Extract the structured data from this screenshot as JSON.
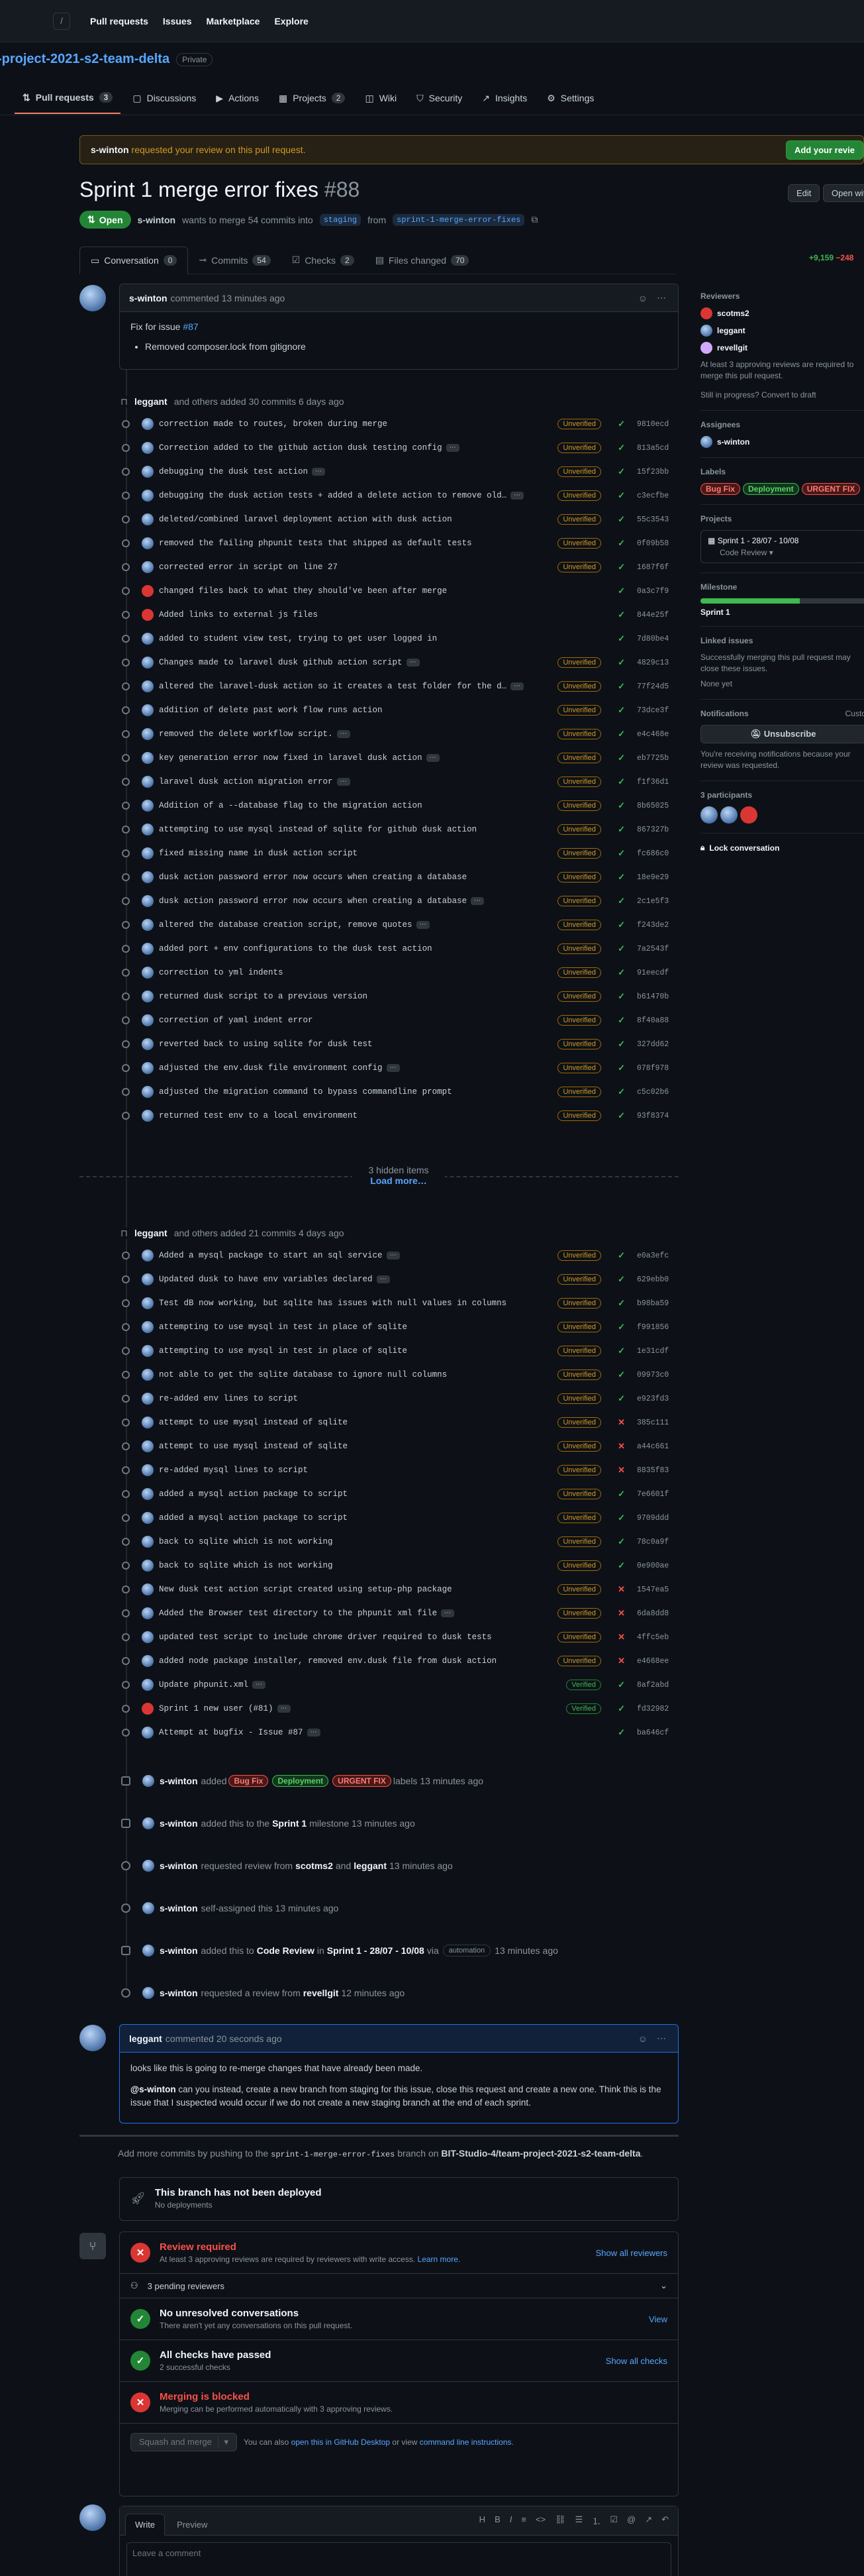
{
  "nav": {
    "items": [
      "Pull requests",
      "Issues",
      "Marketplace",
      "Explore"
    ]
  },
  "repo": {
    "name": "-project-2021-s2-team-delta",
    "visibility": "Private"
  },
  "tabs": [
    {
      "label": "Pull requests",
      "count": "3"
    },
    {
      "label": "Discussions"
    },
    {
      "label": "Actions"
    },
    {
      "label": "Projects",
      "count": "2"
    },
    {
      "label": "Wiki"
    },
    {
      "label": "Security"
    },
    {
      "label": "Insights"
    },
    {
      "label": "Settings"
    }
  ],
  "banner": {
    "user": "s-winton",
    "text": "requested your review on this pull request.",
    "button": "Add your revie"
  },
  "pr": {
    "title": "Sprint 1 merge error fixes",
    "number": "#88",
    "state": "Open",
    "author": "s-winton",
    "merge_text": "wants to merge 54 commits into",
    "base": "staging",
    "from": "from",
    "head": "sprint-1-merge-error-fixes",
    "edit": "Edit",
    "open_with": "Open with"
  },
  "pr_tabs": [
    {
      "label": "Conversation",
      "count": "0"
    },
    {
      "label": "Commits",
      "count": "54"
    },
    {
      "label": "Checks",
      "count": "2"
    },
    {
      "label": "Files changed",
      "count": "70"
    }
  ],
  "diffstat": {
    "add": "+9,159",
    "del": "−248"
  },
  "first_comment": {
    "author": "s-winton",
    "meta": "commented 13 minutes ago",
    "line1": "Fix for issue",
    "issue": "#87",
    "bullet": "Removed composer.lock from gitignore"
  },
  "group1": {
    "author": "leggant",
    "text": "and others added 30 commits 6 days ago"
  },
  "commits1": [
    {
      "msg": "correction made to routes, broken during merge",
      "badge": "Unverified",
      "status": "ok",
      "sha": "9810ecd"
    },
    {
      "msg": "Correction added to the github action dusk testing config",
      "more": true,
      "badge": "Unverified",
      "status": "ok",
      "sha": "813a5cd"
    },
    {
      "msg": "debugging the dusk test action",
      "more": true,
      "badge": "Unverified",
      "status": "ok",
      "sha": "15f23bb"
    },
    {
      "msg": "debugging the dusk action tests + added a delete action to remove old…",
      "more": true,
      "badge": "Unverified",
      "status": "ok",
      "sha": "c3ecfbe"
    },
    {
      "msg": "deleted/combined laravel deployment action with dusk action",
      "badge": "Unverified",
      "status": "ok",
      "sha": "55c3543"
    },
    {
      "msg": "removed the failing phpunit tests that shipped as default tests",
      "badge": "Unverified",
      "status": "ok",
      "sha": "0f09b58"
    },
    {
      "msg": "corrected error in script on line 27",
      "badge": "Unverified",
      "status": "ok",
      "sha": "1687f6f"
    },
    {
      "msg": "changed files back to what they should've been after merge",
      "av": "red",
      "status": "ok",
      "sha": "0a3c7f9"
    },
    {
      "msg": "Added links to external js files",
      "av": "red",
      "status": "ok",
      "sha": "844e25f"
    },
    {
      "msg": "added to student view test, trying to get user logged in",
      "status": "ok",
      "sha": "7d80be4"
    },
    {
      "msg": "Changes made to laravel dusk github action script",
      "more": true,
      "badge": "Unverified",
      "status": "ok",
      "sha": "4829c13"
    },
    {
      "msg": "altered the laravel-dusk action so it creates a test folder for the d…",
      "more": true,
      "badge": "Unverified",
      "status": "ok",
      "sha": "77f24d5"
    },
    {
      "msg": "addition of delete past work flow runs action",
      "badge": "Unverified",
      "status": "ok",
      "sha": "73dce3f"
    },
    {
      "msg": "removed the delete workflow script.",
      "more": true,
      "badge": "Unverified",
      "status": "ok",
      "sha": "e4c468e"
    },
    {
      "msg": "key generation error now fixed in laravel dusk action",
      "more": true,
      "badge": "Unverified",
      "status": "ok",
      "sha": "eb7725b"
    },
    {
      "msg": "laravel dusk action migration error",
      "more": true,
      "badge": "Unverified",
      "status": "ok",
      "sha": "f1f36d1"
    },
    {
      "msg": "Addition of a --database flag to the migration action",
      "badge": "Unverified",
      "status": "ok",
      "sha": "8b65025"
    },
    {
      "msg": "attempting to use mysql instead of sqlite for github dusk action",
      "badge": "Unverified",
      "status": "ok",
      "sha": "867327b"
    },
    {
      "msg": "fixed missing name in dusk action script",
      "badge": "Unverified",
      "status": "ok",
      "sha": "fc686c0"
    },
    {
      "msg": "dusk action password error now occurs when creating a database",
      "badge": "Unverified",
      "status": "ok",
      "sha": "18e9e29"
    },
    {
      "msg": "dusk action password error now occurs when creating a database",
      "more": true,
      "badge": "Unverified",
      "status": "ok",
      "sha": "2c1e5f3"
    },
    {
      "msg": "altered the database creation script, remove quotes",
      "more": true,
      "badge": "Unverified",
      "status": "ok",
      "sha": "f243de2"
    },
    {
      "msg": "added port + env configurations to the dusk test action",
      "badge": "Unverified",
      "status": "ok",
      "sha": "7a2543f"
    },
    {
      "msg": "correction to yml indents",
      "badge": "Unverified",
      "status": "ok",
      "sha": "91eecdf"
    },
    {
      "msg": "returned dusk script to a previous version",
      "badge": "Unverified",
      "status": "ok",
      "sha": "b61470b"
    },
    {
      "msg": "correction of yaml indent error",
      "badge": "Unverified",
      "status": "ok",
      "sha": "8f40a88"
    },
    {
      "msg": "reverted back to using sqlite for dusk test",
      "badge": "Unverified",
      "status": "ok",
      "sha": "327dd62"
    },
    {
      "msg": "adjusted the env.dusk file environment config",
      "more": true,
      "badge": "Unverified",
      "status": "ok",
      "sha": "078f978"
    },
    {
      "msg": "adjusted the migration command to bypass commandline prompt",
      "badge": "Unverified",
      "status": "ok",
      "sha": "c5c02b6"
    },
    {
      "msg": "returned test env to a local environment",
      "badge": "Unverified",
      "status": "ok",
      "sha": "93f8374"
    }
  ],
  "hidden_items": {
    "text": "3 hidden items",
    "link": "Load more…"
  },
  "group2": {
    "author": "leggant",
    "text": "and others added 21 commits 4 days ago"
  },
  "commits2": [
    {
      "msg": "Added a mysql package to start an sql service",
      "more": true,
      "badge": "Unverified",
      "status": "ok",
      "sha": "e0a3efc"
    },
    {
      "msg": "Updated dusk to have env variables declared",
      "more": true,
      "badge": "Unverified",
      "status": "ok",
      "sha": "629ebb0"
    },
    {
      "msg": "Test dB now working, but sqlite has issues with null values in columns",
      "badge": "Unverified",
      "status": "ok",
      "sha": "b98ba59"
    },
    {
      "msg": "attempting to use mysql in test in place of sqlite",
      "badge": "Unverified",
      "status": "ok",
      "sha": "f991856"
    },
    {
      "msg": "attempting to use mysql in test in place of sqlite",
      "badge": "Unverified",
      "status": "ok",
      "sha": "1e31cdf"
    },
    {
      "msg": "not able to get the sqlite database to ignore null columns",
      "badge": "Unverified",
      "status": "ok",
      "sha": "09973c0"
    },
    {
      "msg": "re-added env lines to script",
      "badge": "Unverified",
      "status": "ok",
      "sha": "e923fd3"
    },
    {
      "msg": "attempt to use mysql instead of sqlite",
      "badge": "Unverified",
      "status": "fail",
      "sha": "385c111"
    },
    {
      "msg": "attempt to use mysql instead of sqlite",
      "badge": "Unverified",
      "status": "fail",
      "sha": "a44c661"
    },
    {
      "msg": "re-added mysql lines to script",
      "badge": "Unverified",
      "status": "fail",
      "sha": "8835f83"
    },
    {
      "msg": "added a mysql action package to script",
      "badge": "Unverified",
      "status": "ok",
      "sha": "7e6601f"
    },
    {
      "msg": "added a mysql action package to script",
      "badge": "Unverified",
      "status": "ok",
      "sha": "9709ddd"
    },
    {
      "msg": "back to sqlite which is not working",
      "badge": "Unverified",
      "status": "ok",
      "sha": "78c0a9f"
    },
    {
      "msg": "back to sqlite which is not working",
      "badge": "Unverified",
      "status": "ok",
      "sha": "0e900ae"
    },
    {
      "msg": "New dusk test action script created using setup-php package",
      "badge": "Unverified",
      "status": "fail",
      "sha": "1547ea5"
    },
    {
      "msg": "Added the Browser test directory to the phpunit xml file",
      "more": true,
      "badge": "Unverified",
      "status": "fail",
      "sha": "6da8dd8"
    },
    {
      "msg": "updated test script to include chrome driver required to dusk tests",
      "badge": "Unverified",
      "status": "fail",
      "sha": "4ffc5eb"
    },
    {
      "msg": "added node package installer, removed env.dusk file from dusk action",
      "badge": "Unverified",
      "status": "fail",
      "sha": "e4668ee"
    },
    {
      "msg": "Update phpunit.xml",
      "more": true,
      "badge": "Verified",
      "status": "ok",
      "sha": "8af2abd"
    },
    {
      "msg": "Sprint 1 new user (#81)",
      "more": true,
      "av": "red",
      "badge": "Verified",
      "status": "ok",
      "sha": "fd32982"
    },
    {
      "msg": "Attempt at bugfix - Issue #87",
      "more": true,
      "status": "ok",
      "sha": "ba646cf"
    }
  ],
  "events": [
    {
      "user": "s-winton",
      "pre": "added",
      "labels": [
        {
          "t": "Bug Fix",
          "c": "#f85149"
        },
        {
          "t": "Deployment",
          "c": "#3fb950"
        },
        {
          "t": "URGENT FIX",
          "c": "#f85149"
        }
      ],
      "post": "labels 13 minutes ago"
    },
    {
      "user": "s-winton",
      "pre": "added this to the",
      "target": "Sprint 1",
      "post": "milestone 13 minutes ago"
    },
    {
      "user": "s-winton",
      "pre": "requested review from",
      "target": "scotms2",
      "mid": "and",
      "target2": "leggant",
      "post": "13 minutes ago"
    },
    {
      "user": "s-winton",
      "pre": "self-assigned this 13 minutes ago"
    },
    {
      "user": "s-winton",
      "pre": "added this to",
      "target": "Code Review",
      "mid": "in",
      "target2": "Sprint 1 - 28/07 - 10/08",
      "post2": "via",
      "chip": "automation",
      "post": "13 minutes ago"
    },
    {
      "user": "s-winton",
      "pre": "requested a review from",
      "target": "revellgit",
      "post": "12 minutes ago"
    }
  ],
  "second_comment": {
    "author": "leggant",
    "meta": "commented 20 seconds ago",
    "p1": "looks like this is going to re-merge changes that have already been made.",
    "mention": "@s-winton",
    "p2": "can you instead, create a new branch from staging for this issue, close this request and create a new one. Think this is the issue that I suspected would occur if we do not create a new staging branch at the end of each sprint."
  },
  "push_hint": {
    "pre": "Add more commits by pushing to the",
    "branch": "sprint-1-merge-error-fixes",
    "mid": "branch on",
    "repo": "BIT-Studio-4/team-project-2021-s2-team-delta",
    "post": "."
  },
  "deploy": {
    "title": "This branch has not been deployed",
    "sub": "No deployments"
  },
  "merge": {
    "review": {
      "title": "Review required",
      "sub": "At least 3 approving reviews are required by reviewers with write access.",
      "link": "Learn more.",
      "action": "Show all reviewers"
    },
    "pending": "3 pending reviewers",
    "conv": {
      "title": "No unresolved conversations",
      "sub": "There aren't yet any conversations on this pull request.",
      "action": "View"
    },
    "checks": {
      "title": "All checks have passed",
      "sub": "2 successful checks",
      "action": "Show all checks"
    },
    "blocked": {
      "title": "Merging is blocked",
      "sub": "Merging can be performed automatically with 3 approving reviews."
    },
    "button": "Squash and merge",
    "alt_pre": "You can also",
    "alt_link1": "open this in GitHub Desktop",
    "alt_mid": "or view",
    "alt_link2": "command line instructions",
    "alt_post": "."
  },
  "editor": {
    "write": "Write",
    "preview": "Preview",
    "placeholder": "Leave a comment"
  },
  "sidebar": {
    "reviewers_h": "Reviewers",
    "reviewers": [
      "scotms2",
      "leggant",
      "revellgit"
    ],
    "reviewers_note": "At least 3 approving reviews are required to merge this pull request.",
    "draft": "Still in progress? Convert to draft",
    "assignees_h": "Assignees",
    "assignee": "s-winton",
    "labels_h": "Labels",
    "labels": [
      {
        "t": "Bug Fix",
        "c": "#f85149"
      },
      {
        "t": "Deployment",
        "c": "#3fb950"
      },
      {
        "t": "URGENT FIX",
        "c": "#f85149"
      }
    ],
    "projects_h": "Projects",
    "project": "Sprint 1 - 28/07 - 10/08",
    "project_col": "Code Review",
    "milestone_h": "Milestone",
    "milestone": "Sprint 1",
    "milestone_progress": 0.6,
    "linked_h": "Linked issues",
    "linked_note": "Successfully merging this pull request may close these issues.",
    "linked_none": "None yet",
    "notif_h": "Notifications",
    "notif_cust": "Custo",
    "unsub": "Unsubscribe",
    "notif_note": "You're receiving notifications because your review was requested.",
    "participants_h": "3 participants",
    "lock": "Lock conversation"
  }
}
